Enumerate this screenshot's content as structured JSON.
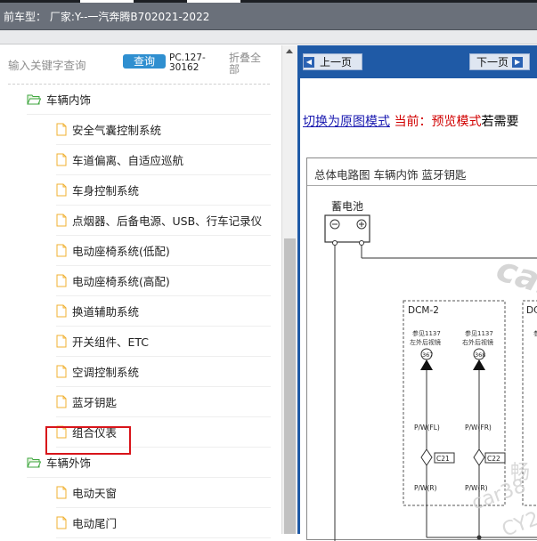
{
  "header": {
    "title": "前车型： 厂家:Y--一汽奔腾B702021-2022"
  },
  "search": {
    "placeholder": "输入关键字查询",
    "query_button": "查询",
    "code": "PC.127-30162",
    "fold_all": "折叠全部"
  },
  "tree": {
    "interior_folder": "车辆内饰",
    "interior_items": [
      "安全气囊控制系统",
      "车道偏离、自适应巡航",
      "车身控制系统",
      "点烟器、后备电源、USB、行车记录仪",
      "电动座椅系统(低配)",
      "电动座椅系统(高配)",
      "换道辅助系统",
      "开关组件、ETC",
      "空调控制系统",
      "蓝牙钥匙",
      "组合仪表"
    ],
    "exterior_folder": "车辆外饰",
    "exterior_items": [
      "电动天窗",
      "电动尾门"
    ],
    "selected": "蓝牙钥匙"
  },
  "viewer": {
    "prev_button": "上一页",
    "next_button": "下一页",
    "switch_link": "切换为原图模式",
    "current_label": " 当前：预览模式",
    "tail_text": "若需要",
    "diagram_title": "总体电路图  车辆内饰  蓝牙钥匙",
    "battery_label": "蓄电池",
    "module_a": "DCM-2",
    "module_b": "DC",
    "ref_a_1": "参见1137",
    "ref_a_2": "左外后视镜",
    "ref_b_1": "参见1137",
    "ref_b_2": "右外后视镜",
    "ref_c": "参",
    "pin_a": "367",
    "pin_b": "368",
    "wire_a1": "P/W(FL)",
    "wire_b1": "P/W(FR)",
    "conn_a": "C21",
    "conn_b": "C22",
    "wire_a2": "P/W(R)",
    "wire_b2": "P/W(R)",
    "watermark_1": "car",
    "watermark_2": "畅",
    "watermark_3": "car38",
    "watermark_4": "CY2"
  },
  "colors": {
    "accent": "#2f8fd0",
    "highlight": "#d8141a",
    "nav": "#1f5aa6",
    "folder": "#3fa63f",
    "file": "#f0b030"
  }
}
